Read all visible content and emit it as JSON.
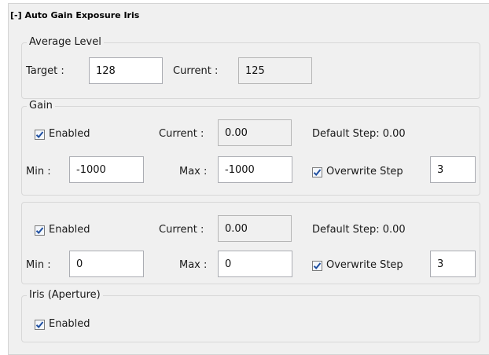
{
  "header": {
    "title": "[-] Auto Gain Exposure Iris"
  },
  "average_level": {
    "legend": "Average Level",
    "target_label": "Target :",
    "target_value": "128",
    "current_label": "Current :",
    "current_value": "125"
  },
  "gain": {
    "legend": "Gain",
    "enabled_label": "Enabled",
    "enabled_checked": true,
    "current_label": "Current :",
    "current_value": "0.00",
    "default_step": "Default Step: 0.00",
    "min_label": "Min :",
    "min_value": "-1000",
    "max_label": "Max :",
    "max_value": "-1000",
    "overwrite_label": "Overwrite Step",
    "overwrite_checked": true,
    "step_value": "3"
  },
  "exposure": {
    "enabled_label": "Enabled",
    "enabled_checked": true,
    "current_label": "Current :",
    "current_value": "0.00",
    "default_step": "Default Step: 0.00",
    "min_label": "Min :",
    "min_value": "0",
    "max_label": "Max :",
    "max_value": "0",
    "overwrite_label": "Overwrite Step",
    "overwrite_checked": true,
    "step_value": "3"
  },
  "iris": {
    "legend": "Iris (Aperture)",
    "enabled_label": "Enabled",
    "enabled_checked": true
  },
  "icons": {
    "check": "checkmark-icon"
  },
  "colors": {
    "panel_bg": "#f0f0f0",
    "check": "#1f4fa0"
  }
}
